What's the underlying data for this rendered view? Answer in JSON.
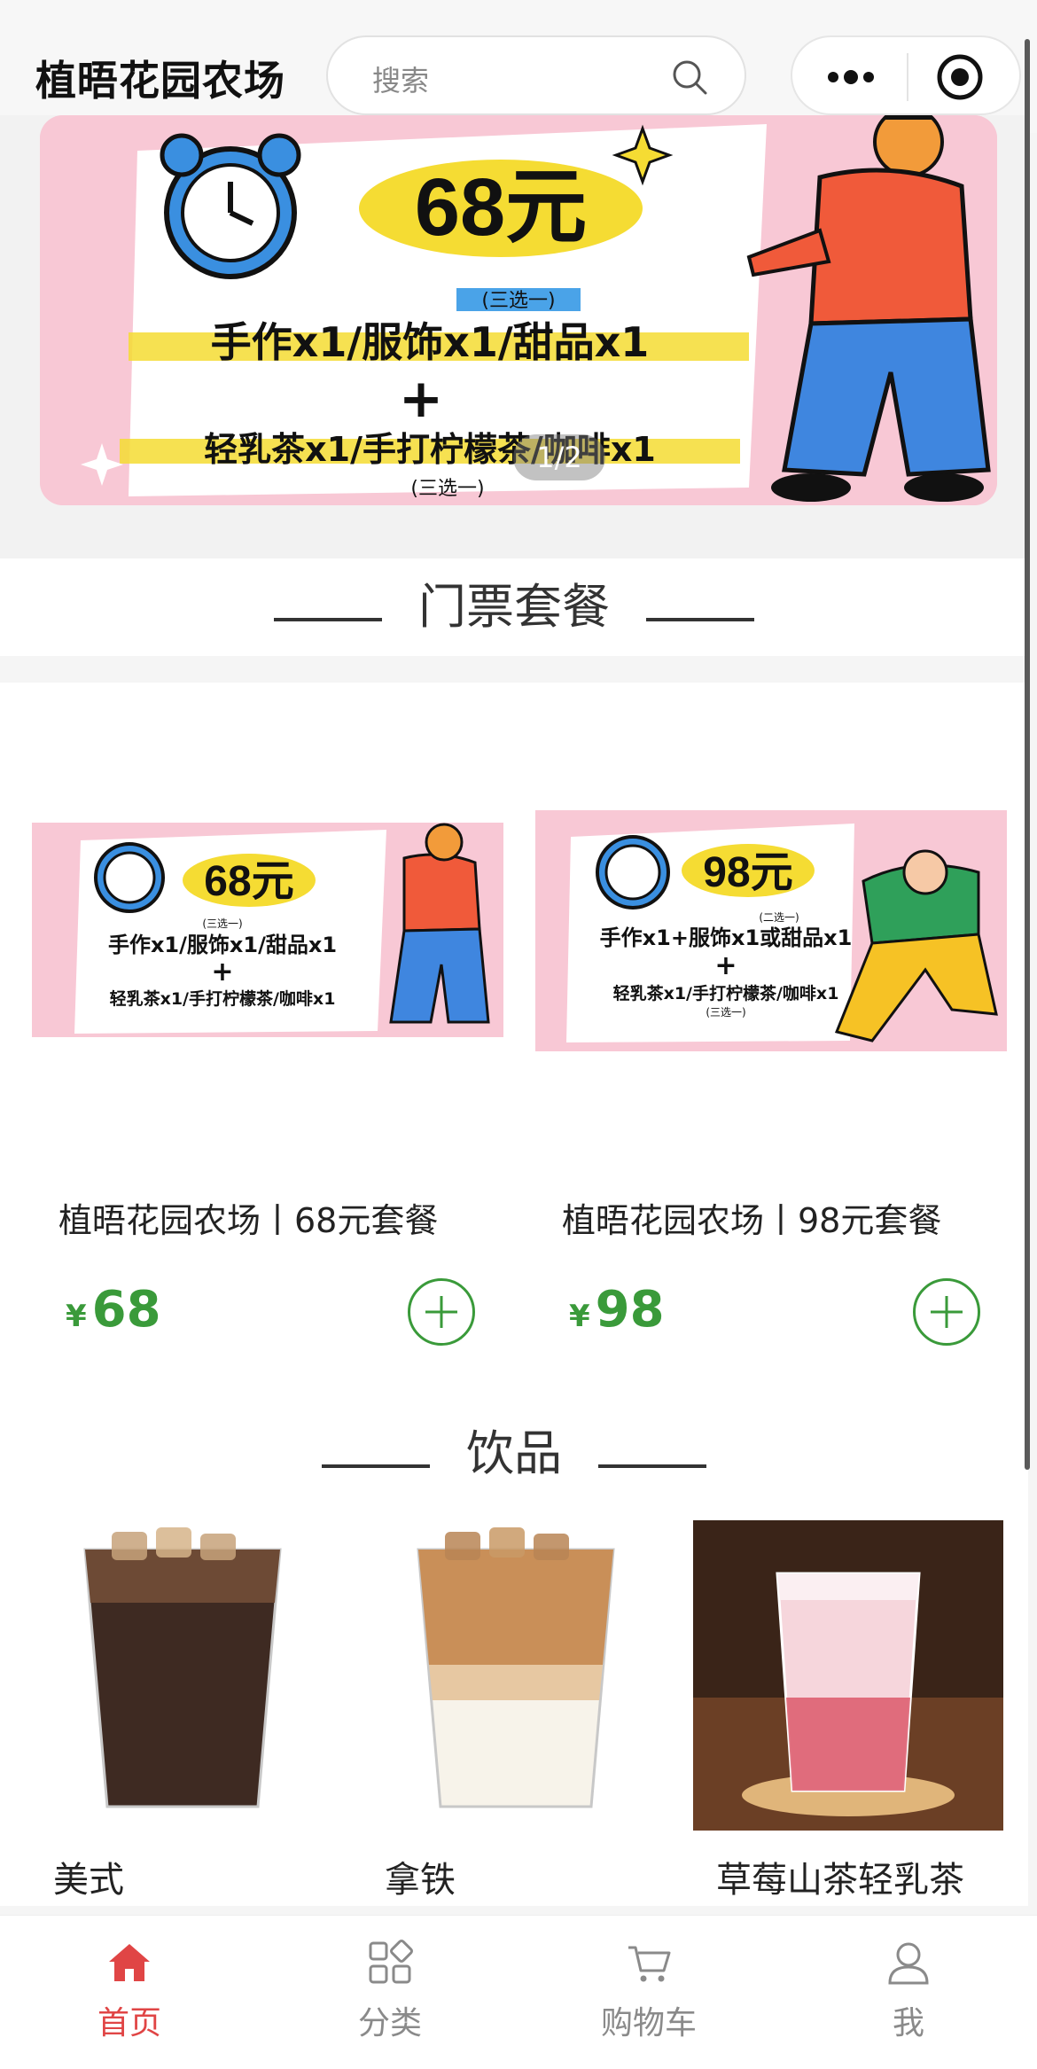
{
  "header": {
    "title": "植晤花园农场",
    "search_placeholder": "搜索"
  },
  "banner": {
    "pager": "1/2",
    "price": "68元",
    "choice_note": "(三选一)",
    "line1": "手作x1/服饰x1/甜品x1",
    "plus": "+",
    "line2": "轻乳茶x1/手打柠檬茶/咖啡x1"
  },
  "sections": {
    "tickets": "门票套餐",
    "drinks": "饮品"
  },
  "packages": [
    {
      "name": "植晤花园农场丨68元套餐",
      "currency": "¥",
      "price": "68",
      "img_price": "68元",
      "img_note": "(三选一)",
      "img_line1": "手作x1/服饰x1/甜品x1",
      "img_line2": "轻乳茶x1/手打柠檬茶/咖啡x1"
    },
    {
      "name": "植晤花园农场丨98元套餐",
      "currency": "¥",
      "price": "98",
      "img_price": "98元",
      "img_note": "(二选一)",
      "img_line1": "手作x1+服饰x1或甜品x1",
      "img_line2": "轻乳茶x1/手打柠檬茶/咖啡x1",
      "img_note2": "(三选一)"
    }
  ],
  "drinks": [
    {
      "name": "美式"
    },
    {
      "name": "拿铁"
    },
    {
      "name": "草莓山茶轻乳茶"
    }
  ],
  "tabbar": [
    {
      "label": "首页",
      "icon": "home-icon",
      "active": true
    },
    {
      "label": "分类",
      "icon": "category-icon",
      "active": false
    },
    {
      "label": "购物车",
      "icon": "cart-icon",
      "active": false
    },
    {
      "label": "我",
      "icon": "user-icon",
      "active": false
    }
  ],
  "colors": {
    "accent_green": "#3a9a3a",
    "active_red": "#e04545",
    "banner_pink": "#f8c8d5"
  }
}
